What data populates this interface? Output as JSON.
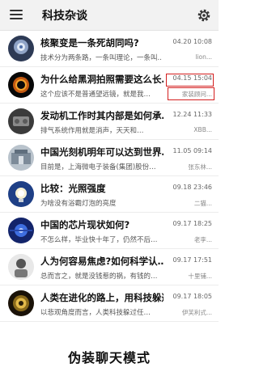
{
  "header": {
    "title": "科技杂谈"
  },
  "rows": [
    {
      "title": "核聚变是一条死胡同吗?",
      "preview": "技术分为两条路，一条叫理论，一条叫...",
      "time": "04.20 10:08",
      "sender": "lion..."
    },
    {
      "title": "为什么给黑洞拍照需要这么长…",
      "preview": "这个应该不是普通望远镜，就是我…",
      "time": "04.15 15:04",
      "sender": "家装顾问..."
    },
    {
      "title": "发动机工作时其内部是如何承…",
      "preview": "排气系统作用就是消声，天天和…",
      "time": "12.24 11:33",
      "sender": "XBB..."
    },
    {
      "title": "中国光刻机明年可以达到世界…",
      "preview": "目前是，上海微电子装备(集团)股份…",
      "time": "11.05 09:14",
      "sender": "张东林..."
    },
    {
      "title": "比较：光照强度",
      "preview": "为啥没有浴霸灯泡的亮度",
      "time": "09.18 23:46",
      "sender": "二猫..."
    },
    {
      "title": "中国的芯片现状如何?",
      "preview": "不怎么样，毕业快十年了，仍然不后…",
      "time": "09.17 18:25",
      "sender": "老李..."
    },
    {
      "title": "人为何容易焦虑?如何科学认…",
      "preview": "总而言之，就是没钱惹的祸，有钱的…",
      "time": "09.17 17:51",
      "sender": "十里铺..."
    },
    {
      "title": "人类在进化的路上，用科技躲避了多少…",
      "preview": "以悲观角度而言，人类科技躲过任…",
      "time": "09.17 18:05",
      "sender": "伊芙利式..."
    }
  ],
  "caption": "伪装聊天模式",
  "colors": {
    "highlight": "#d41e1e",
    "topbar": "#f2f2f2"
  },
  "icons": {
    "menu": "hamburger-menu-icon",
    "settings": "gear-icon"
  }
}
